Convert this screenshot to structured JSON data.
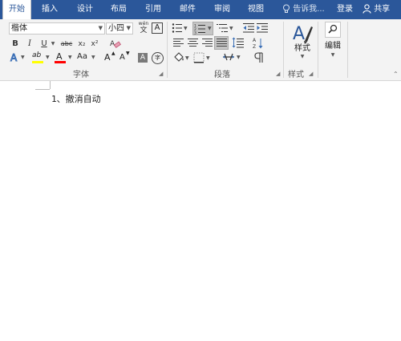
{
  "menu": {
    "tabs": [
      "开始",
      "插入",
      "设计",
      "布局",
      "引用",
      "邮件",
      "审阅",
      "视图"
    ],
    "tell_me": "告诉我...",
    "login": "登录",
    "share": "共享"
  },
  "font": {
    "name": "楷体",
    "size": "小四",
    "wen_label_top": "wén",
    "wen_label_bottom": "文",
    "boxed_a": "A",
    "bold": "B",
    "italic": "I",
    "underline": "U",
    "strike": "abc",
    "subscript": "x₂",
    "superscript": "x²",
    "case": "Aa",
    "highlight_label": "ab",
    "font_color_label": "A",
    "grow": "A",
    "shrink": "A",
    "shade_a": "A",
    "circle_char": "字"
  },
  "groups": {
    "font": "字体",
    "paragraph": "段落",
    "styles": "样式",
    "styles_button": "样式",
    "edit_button": "编辑"
  },
  "colors": {
    "accent": "#2b579a",
    "highlight": "#ffff00",
    "font_color": "#ff0000"
  },
  "document": {
    "line1": "1、撤消自动"
  }
}
